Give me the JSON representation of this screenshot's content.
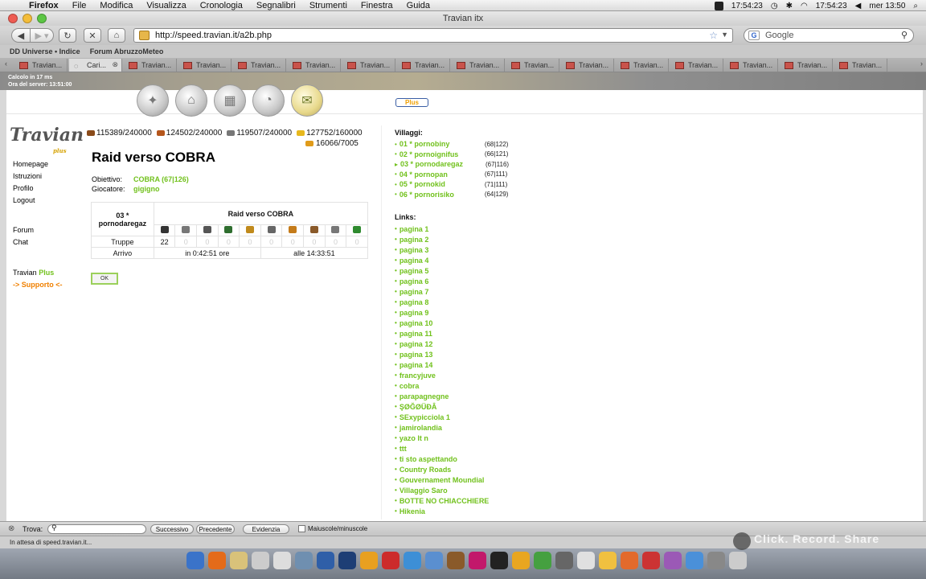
{
  "menubar": {
    "app": "Firefox",
    "items": [
      "File",
      "Modifica",
      "Visualizza",
      "Cronologia",
      "Segnalibri",
      "Strumenti",
      "Finestra",
      "Guida"
    ],
    "clock1": "17:54:23",
    "clock2": "17:54:23",
    "datetime": "mer 13:50"
  },
  "window": {
    "title": "Travian itx"
  },
  "toolbar": {
    "url": "http://speed.travian.it/a2b.php",
    "search_placeholder": "Google"
  },
  "bookmarks": [
    "DD Universe • Indice",
    "Forum AbruzzoMeteo"
  ],
  "tabs": {
    "active_label": "Cari...",
    "label": "Travian..."
  },
  "header": {
    "calc_line": "Calcolo in 17 ms",
    "server_line": "Ora del server: 13:51:00",
    "plus_label": "Plus"
  },
  "leftnav": {
    "items": [
      "Homepage",
      "Istruzioni",
      "Profilo",
      "Logout"
    ],
    "items2": [
      "Forum",
      "Chat"
    ],
    "travian": "Travian",
    "plus": "Plus",
    "support": "-> Supporto <-"
  },
  "resources": {
    "wood": "115389/240000",
    "clay": "124502/240000",
    "iron": "119507/240000",
    "crop": "127752/160000",
    "consumption": "16066/7005"
  },
  "main": {
    "title": "Raid verso COBRA",
    "target_label": "Obiettivo:",
    "target_value": "COBRA (67|126)",
    "player_label": "Giocatore:",
    "player_value": "gigigno",
    "table": {
      "village": "03 * pornodaregaz",
      "header": "Raid verso COBRA",
      "troops_label": "Truppe",
      "troops": [
        "22",
        "0",
        "0",
        "0",
        "0",
        "0",
        "0",
        "0",
        "0",
        "0"
      ],
      "arrival_label": "Arrivo",
      "arrival_in": "in 0:42:51 ore",
      "arrival_at": "alle 14:33:51"
    },
    "ok_label": "OK"
  },
  "villages": {
    "title": "Villaggi:",
    "items": [
      {
        "name": "01 * pornobiny",
        "coord": "(68|122)"
      },
      {
        "name": "02 * pornoignifus",
        "coord": "(66|121)"
      },
      {
        "name": "03 * pornodaregaz",
        "coord": "(67|116)"
      },
      {
        "name": "04 * pornopan",
        "coord": "(67|111)"
      },
      {
        "name": "05 * pornokid",
        "coord": "(71|111)"
      },
      {
        "name": "06 * pornorisiko",
        "coord": "(64|129)"
      }
    ]
  },
  "links": {
    "title": "Links:",
    "items": [
      "pagina 1",
      "pagina 2",
      "pagina 3",
      "pagina 4",
      "pagina 5",
      "pagina 6",
      "pagina 7",
      "pagina 8",
      "pagina 9",
      "pagina 10",
      "pagina 11",
      "pagina 12",
      "pagina 13",
      "pagina 14",
      "francyjuve",
      "cobra",
      "parapagnegne",
      "ŞØĞØÜĐÂ",
      "SExypicciola 1",
      "jamirolandia",
      "yazo lt n",
      "ttt",
      "ti sto aspettando",
      "Country Roads",
      "Gouvernament Moundial",
      "Villaggio Saro",
      "BOTTE NO CHIACCHIERE",
      "Hikenia"
    ]
  },
  "findbar": {
    "label": "Trova:",
    "next": "Successivo",
    "prev": "Precedente",
    "highlight": "Evidenzia",
    "case": "Maiuscole/minuscole"
  },
  "status": {
    "text": "In attesa di speed.travian.it..."
  },
  "watermark": "Click. Record. Share",
  "colors": {
    "accent_green": "#71c11c",
    "support_orange": "#f08000"
  }
}
